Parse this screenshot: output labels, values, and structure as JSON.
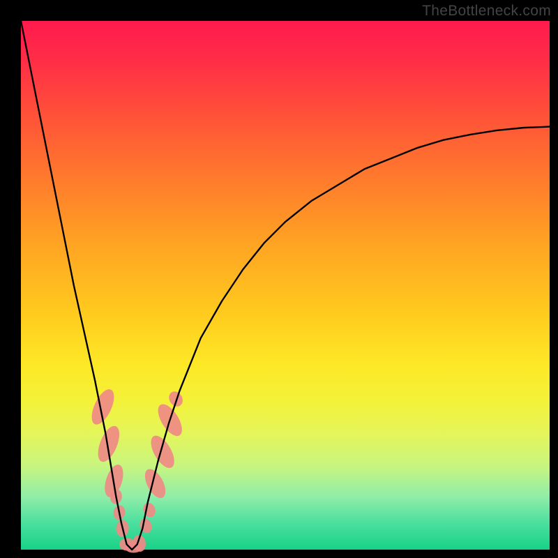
{
  "watermark": "TheBottleneck.com",
  "chart_data": {
    "type": "line",
    "title": "",
    "xlabel": "",
    "ylabel": "",
    "xlim": [
      0,
      100
    ],
    "ylim": [
      0,
      100
    ],
    "x": [
      0,
      2,
      4,
      6,
      8,
      10,
      12,
      14,
      16,
      17,
      18,
      19,
      20,
      21,
      22,
      23,
      24,
      26,
      28,
      30,
      34,
      38,
      42,
      46,
      50,
      55,
      60,
      65,
      70,
      75,
      80,
      85,
      90,
      95,
      100
    ],
    "values": [
      100,
      90,
      80,
      70,
      60,
      50,
      41,
      32,
      22,
      16,
      10,
      5,
      1,
      0,
      1,
      4,
      9,
      17,
      24,
      30,
      40,
      47,
      53,
      58,
      62,
      66,
      69,
      72,
      74,
      76,
      77.5,
      78.5,
      79.3,
      79.8,
      80
    ],
    "annotations": [
      {
        "cx": 15.5,
        "cy": 27,
        "rx": 1.6,
        "ry": 3.6,
        "rot": 25
      },
      {
        "cx": 16.6,
        "cy": 20,
        "rx": 1.6,
        "ry": 3.6,
        "rot": 22
      },
      {
        "cx": 17.6,
        "cy": 13,
        "rx": 1.5,
        "ry": 3.2,
        "rot": 18
      },
      {
        "cx": 18.0,
        "cy": 10,
        "rx": 1.1,
        "ry": 1.4,
        "rot": 10
      },
      {
        "cx": 18.6,
        "cy": 7.0,
        "rx": 1.1,
        "ry": 1.4,
        "rot": 8
      },
      {
        "cx": 19.2,
        "cy": 4.0,
        "rx": 1.2,
        "ry": 1.6,
        "rot": 5
      },
      {
        "cx": 20.1,
        "cy": 1.0,
        "rx": 1.5,
        "ry": 1.2,
        "rot": 0
      },
      {
        "cx": 21.3,
        "cy": 0.4,
        "rx": 1.6,
        "ry": 1.0,
        "rot": 0
      },
      {
        "cx": 22.4,
        "cy": 1.2,
        "rx": 1.2,
        "ry": 1.6,
        "rot": -10
      },
      {
        "cx": 23.6,
        "cy": 4.5,
        "rx": 1.1,
        "ry": 1.4,
        "rot": -20
      },
      {
        "cx": 24.3,
        "cy": 7.5,
        "rx": 1.1,
        "ry": 1.4,
        "rot": -22
      },
      {
        "cx": 25.4,
        "cy": 12.5,
        "rx": 1.5,
        "ry": 3.0,
        "rot": -28
      },
      {
        "cx": 26.8,
        "cy": 18.5,
        "rx": 1.6,
        "ry": 3.4,
        "rot": -30
      },
      {
        "cx": 28.2,
        "cy": 24.5,
        "rx": 1.6,
        "ry": 3.4,
        "rot": -32
      },
      {
        "cx": 29.3,
        "cy": 28.5,
        "rx": 1.2,
        "ry": 1.5,
        "rot": -32
      }
    ],
    "gradient_stops": [
      {
        "pct": 0,
        "color": "#ff1a4d"
      },
      {
        "pct": 8,
        "color": "#ff2f46"
      },
      {
        "pct": 18,
        "color": "#ff5238"
      },
      {
        "pct": 30,
        "color": "#ff7b2c"
      },
      {
        "pct": 42,
        "color": "#ffa323"
      },
      {
        "pct": 55,
        "color": "#ffca1e"
      },
      {
        "pct": 65,
        "color": "#fde826"
      },
      {
        "pct": 72,
        "color": "#f3f23a"
      },
      {
        "pct": 78,
        "color": "#e4f55a"
      },
      {
        "pct": 84,
        "color": "#c9f57e"
      },
      {
        "pct": 90,
        "color": "#90eda8"
      },
      {
        "pct": 95,
        "color": "#4bdf9e"
      },
      {
        "pct": 100,
        "color": "#18d286"
      }
    ]
  }
}
